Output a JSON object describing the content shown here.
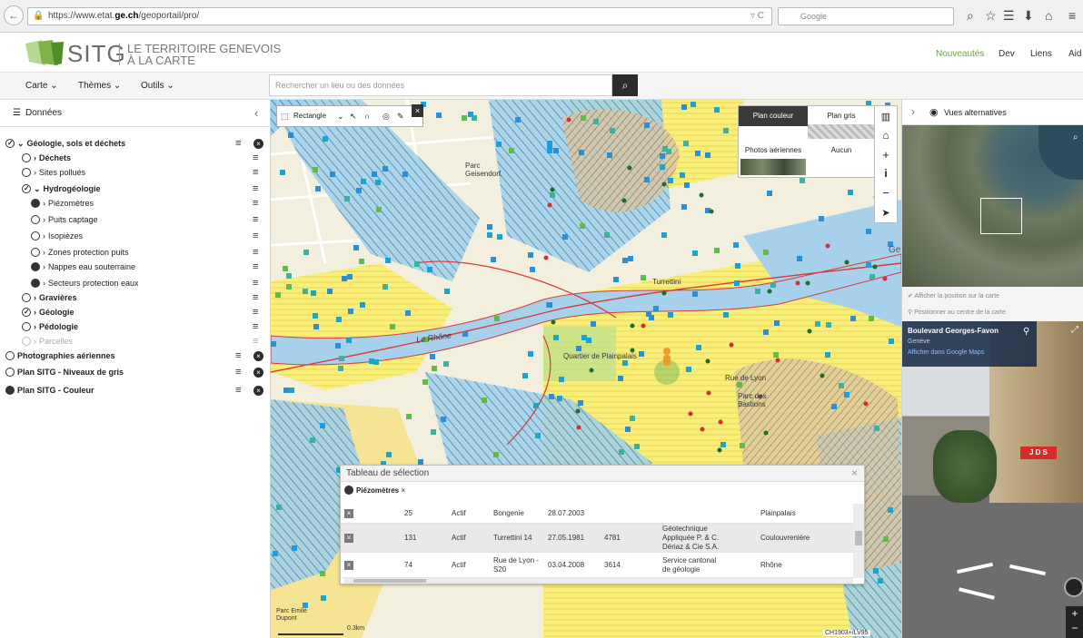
{
  "browser": {
    "url_prefix": "https://www.etat.",
    "url_domain": "ge.ch",
    "url_path": "/geoportail/pro/",
    "url_controls": "▿ C",
    "search_engine": "Google"
  },
  "header": {
    "logo": "SITG",
    "tagline_line1": "LE TERRITOIRE GENEVOIS",
    "tagline_line2": "À LA CARTE",
    "links": [
      "Nouveautés",
      "Dev",
      "Liens",
      "Aid"
    ],
    "accent": "#8dc63f"
  },
  "toolbar": {
    "menus": [
      "Carte",
      "Thèmes",
      "Outils"
    ],
    "search_placeholder": "Rechercher un lieu ou des données"
  },
  "panel": {
    "title": "Données",
    "layers": [
      {
        "label": "Géologie, sols et déchets",
        "level": 0,
        "state": "check",
        "expand": "down",
        "bold": true
      },
      {
        "label": "Déchets",
        "level": 1,
        "state": "empty",
        "expand": "right",
        "bold": true
      },
      {
        "label": "Sites pollués",
        "level": 1,
        "state": "empty",
        "expand": "right",
        "bold": false
      },
      {
        "label": "Hydrogéologie",
        "level": 1,
        "state": "check",
        "expand": "down",
        "bold": true
      },
      {
        "label": "Piézomètres",
        "level": 2,
        "state": "filled",
        "expand": "right",
        "bold": false
      },
      {
        "label": "Puits captage",
        "level": 2,
        "state": "empty",
        "expand": "right",
        "bold": false
      },
      {
        "label": "Isopièzes",
        "level": 2,
        "state": "empty",
        "expand": "right",
        "bold": false
      },
      {
        "label": "Zones protection puits",
        "level": 2,
        "state": "empty",
        "expand": "right",
        "bold": false
      },
      {
        "label": "Nappes eau souterraine",
        "level": 2,
        "state": "filled",
        "expand": "right",
        "bold": false
      },
      {
        "label": "Secteurs protection eaux",
        "level": 2,
        "state": "filled",
        "expand": "right",
        "bold": false
      },
      {
        "label": "Gravières",
        "level": 1,
        "state": "empty",
        "expand": "right",
        "bold": true
      },
      {
        "label": "Géologie",
        "level": 1,
        "state": "check",
        "expand": "right",
        "bold": true
      },
      {
        "label": "Pédologie",
        "level": 1,
        "state": "empty",
        "expand": "right",
        "bold": true
      },
      {
        "label": "Parcelles",
        "level": 1,
        "state": "faded",
        "expand": "right",
        "bold": false
      },
      {
        "label": "Photographies aériennes",
        "level": 0,
        "state": "empty",
        "expand": "none",
        "bold": true
      },
      {
        "label": "Plan SITG - Niveaux de gris",
        "level": 0,
        "state": "empty",
        "expand": "none",
        "bold": true
      },
      {
        "label": "Plan SITG - Couleur",
        "level": 0,
        "state": "filled",
        "expand": "none",
        "bold": true
      }
    ]
  },
  "map": {
    "tool_label": "Rectangle",
    "basemap_tabs": [
      "Plan couleur",
      "Plan gris",
      "Photos aériennes",
      "Aucun"
    ],
    "labels": [
      "Le Rhône",
      "Parc Geisendorf",
      "Parc des Bastions",
      "Quartier de Plainpalais",
      "Rue de Lyon",
      "Ge",
      "Turrettini"
    ],
    "scale": "0.3km",
    "crs": "CH1903+/LV95",
    "park_label": "Parc Emile Dupont"
  },
  "table": {
    "title": "Tableau de sélection",
    "tab": "Piézomètres",
    "rows": [
      {
        "id": "25",
        "status": "Actif",
        "name": "Bongenie",
        "date": "28.07.2003",
        "num": "",
        "org": "",
        "commune": "Plainpalais"
      },
      {
        "id": "131",
        "status": "Actif",
        "name": "Turrettini 14",
        "date": "27.05.1981",
        "num": "4781",
        "org": "Géotechnique Appliquée P. & C. Dériaz & Cie S.A.",
        "commune": "Coulouvrenière"
      },
      {
        "id": "74",
        "status": "Actif",
        "name": "Rue de Lyon - S20",
        "date": "03.04.2008",
        "num": "3614",
        "org": "Service cantonal de géologie",
        "commune": "Rhône"
      }
    ]
  },
  "right": {
    "title": "Vues alternatives",
    "options": [
      "Afficher la position sur la carte",
      "Positionner au centre de la carte"
    ],
    "street_name": "Boulevard Georges-Favon",
    "city": "Genève",
    "google_link": "Afficher dans Google Maps",
    "sign": "J D S"
  }
}
